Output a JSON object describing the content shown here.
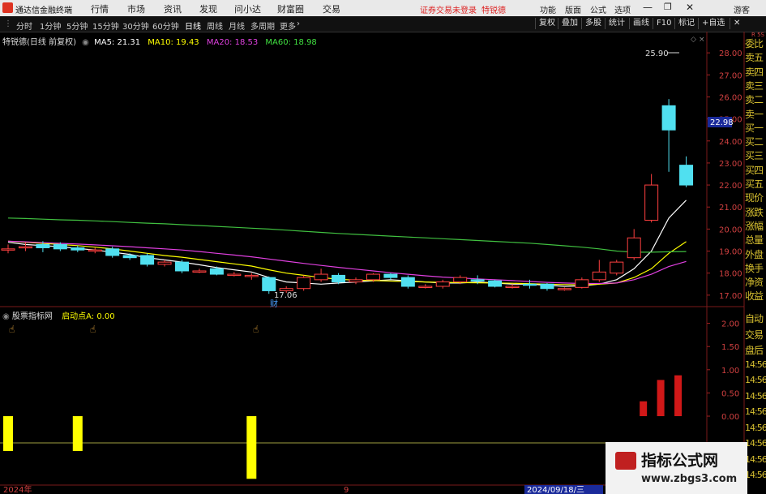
{
  "menubar": {
    "app_title": "通达信金融终端",
    "menus": [
      "行情",
      "市场",
      "资讯",
      "发现",
      "问小达",
      "财富圈",
      "交易"
    ],
    "notice": "证券交易未登录",
    "account": "特锐德",
    "right_menus": [
      "功能",
      "版面",
      "公式",
      "选项"
    ],
    "guest": "游客"
  },
  "toolbar": {
    "periods": [
      "分时",
      "1分钟",
      "5分钟",
      "15分钟",
      "30分钟",
      "60分钟",
      "日线",
      "周线",
      "月线",
      "多周期",
      "更多"
    ],
    "active_period": "日线",
    "right_buttons": [
      "复权",
      "叠加",
      "多股",
      "统计",
      "画线",
      "F10",
      "标记",
      "+自选"
    ]
  },
  "main_chart": {
    "header_name": "特锐德(日线 前复权)",
    "ma_items": [
      {
        "label": "MA5: 21.31",
        "color": "#ffffff"
      },
      {
        "label": "MA10: 19.43",
        "color": "#ffff00"
      },
      {
        "label": "MA20: 18.53",
        "color": "#e040e0"
      },
      {
        "label": "MA60: 18.98",
        "color": "#40e040"
      }
    ],
    "price_ticks": [
      "28.00",
      "27.00",
      "26.00",
      "25.00",
      "24.00",
      "23.00",
      "22.00",
      "21.00",
      "20.00",
      "19.00",
      "18.00",
      "17.00"
    ],
    "current_price": "22.98",
    "high_label": "25.90",
    "low_label": "17.06",
    "fin_marker": "财"
  },
  "indicator": {
    "name": "股票指标网",
    "value_label": "启动点A: 0.00",
    "ticks": [
      "2.00",
      "1.50",
      "1.00",
      "0.50",
      "0.00"
    ]
  },
  "x_axis": {
    "labels": [
      "2024年",
      "9",
      "2024/09/18/三"
    ]
  },
  "right_sidebar": {
    "top_code": "R 5S",
    "items": [
      "委比",
      "卖五",
      "卖四",
      "卖三",
      "卖二",
      "卖一",
      "买一",
      "买二",
      "买三",
      "买四",
      "买五",
      "现价",
      "涨跌",
      "涨幅",
      "总量",
      "外盘",
      "换手",
      "净资",
      "收益"
    ],
    "bottom_items": [
      "自动",
      "交易",
      "盘后",
      "14:56",
      "14:56",
      "14:56",
      "14:56",
      "14:56",
      "14:56",
      "14:56",
      "14:56"
    ]
  },
  "watermark": {
    "title": "指标公式网",
    "url": "www.zbgs3.com"
  },
  "chart_data": {
    "type": "candlestick",
    "title": "特锐德(日线 前复权)",
    "ylim": [
      16.7,
      28.3
    ],
    "candles": [
      {
        "o": 19.1,
        "c": 19.1,
        "h": 19.3,
        "l": 18.9
      },
      {
        "o": 19.2,
        "c": 19.2,
        "h": 19.4,
        "l": 19.0
      },
      {
        "o": 19.3,
        "c": 19.15,
        "h": 19.45,
        "l": 18.95
      },
      {
        "o": 19.3,
        "c": 19.1,
        "h": 19.4,
        "l": 19.0
      },
      {
        "o": 19.15,
        "c": 19.05,
        "h": 19.25,
        "l": 18.95
      },
      {
        "o": 19.0,
        "c": 19.05,
        "h": 19.15,
        "l": 18.9
      },
      {
        "o": 19.1,
        "c": 18.8,
        "h": 19.2,
        "l": 18.7
      },
      {
        "o": 18.8,
        "c": 18.7,
        "h": 18.9,
        "l": 18.6
      },
      {
        "o": 18.8,
        "c": 18.4,
        "h": 18.9,
        "l": 18.3
      },
      {
        "o": 18.4,
        "c": 18.5,
        "h": 18.6,
        "l": 18.3
      },
      {
        "o": 18.5,
        "c": 18.1,
        "h": 18.6,
        "l": 18.0
      },
      {
        "o": 18.1,
        "c": 18.1,
        "h": 18.2,
        "l": 18.0
      },
      {
        "o": 18.2,
        "c": 17.95,
        "h": 18.3,
        "l": 17.9
      },
      {
        "o": 17.95,
        "c": 17.95,
        "h": 18.05,
        "l": 17.85
      },
      {
        "o": 17.9,
        "c": 17.9,
        "h": 18.0,
        "l": 17.7
      },
      {
        "o": 17.8,
        "c": 17.2,
        "h": 17.85,
        "l": 17.06
      },
      {
        "o": 17.2,
        "c": 17.3,
        "h": 17.4,
        "l": 17.1
      },
      {
        "o": 17.3,
        "c": 17.8,
        "h": 17.9,
        "l": 17.2
      },
      {
        "o": 17.7,
        "c": 17.95,
        "h": 18.2,
        "l": 17.6
      },
      {
        "o": 17.9,
        "c": 17.6,
        "h": 18.0,
        "l": 17.5
      },
      {
        "o": 17.6,
        "c": 17.7,
        "h": 17.8,
        "l": 17.5
      },
      {
        "o": 17.7,
        "c": 17.95,
        "h": 18.0,
        "l": 17.6
      },
      {
        "o": 17.95,
        "c": 17.8,
        "h": 18.0,
        "l": 17.7
      },
      {
        "o": 17.8,
        "c": 17.4,
        "h": 17.9,
        "l": 17.3
      },
      {
        "o": 17.4,
        "c": 17.4,
        "h": 17.5,
        "l": 17.3
      },
      {
        "o": 17.4,
        "c": 17.6,
        "h": 17.7,
        "l": 17.3
      },
      {
        "o": 17.6,
        "c": 17.8,
        "h": 17.9,
        "l": 17.5
      },
      {
        "o": 17.7,
        "c": 17.65,
        "h": 17.9,
        "l": 17.5
      },
      {
        "o": 17.65,
        "c": 17.4,
        "h": 17.7,
        "l": 17.35
      },
      {
        "o": 17.4,
        "c": 17.4,
        "h": 17.5,
        "l": 17.3
      },
      {
        "o": 17.5,
        "c": 17.45,
        "h": 17.7,
        "l": 17.3
      },
      {
        "o": 17.5,
        "c": 17.3,
        "h": 17.55,
        "l": 17.2
      },
      {
        "o": 17.25,
        "c": 17.3,
        "h": 17.35,
        "l": 17.2
      },
      {
        "o": 17.35,
        "c": 17.7,
        "h": 17.8,
        "l": 17.3
      },
      {
        "o": 17.7,
        "c": 18.05,
        "h": 18.6,
        "l": 17.6
      },
      {
        "o": 18.0,
        "c": 18.5,
        "h": 18.6,
        "l": 17.9
      },
      {
        "o": 18.7,
        "c": 19.6,
        "h": 20.0,
        "l": 18.6
      },
      {
        "o": 20.4,
        "c": 22.0,
        "h": 22.5,
        "l": 20.3
      },
      {
        "o": 25.6,
        "c": 24.5,
        "h": 25.9,
        "l": 22.6
      },
      {
        "o": 22.9,
        "c": 22.0,
        "h": 23.3,
        "l": 21.9
      }
    ],
    "ma": {
      "MA5": [
        19.4,
        19.3,
        19.25,
        19.2,
        19.12,
        19.05,
        18.95,
        18.85,
        18.7,
        18.6,
        18.5,
        18.38,
        18.25,
        18.15,
        18.05,
        17.8,
        17.6,
        17.55,
        17.5,
        17.55,
        17.6,
        17.65,
        17.7,
        17.65,
        17.6,
        17.55,
        17.55,
        17.6,
        17.55,
        17.5,
        17.5,
        17.45,
        17.4,
        17.42,
        17.5,
        17.7,
        18.2,
        19.0,
        20.5,
        21.31
      ],
      "MA10": [
        19.45,
        19.4,
        19.35,
        19.3,
        19.25,
        19.18,
        19.1,
        19.0,
        18.9,
        18.8,
        18.72,
        18.62,
        18.52,
        18.42,
        18.32,
        18.15,
        18.0,
        17.9,
        17.8,
        17.72,
        17.68,
        17.66,
        17.64,
        17.62,
        17.6,
        17.58,
        17.57,
        17.56,
        17.55,
        17.54,
        17.52,
        17.5,
        17.48,
        17.47,
        17.5,
        17.55,
        17.8,
        18.2,
        18.9,
        19.43
      ],
      "MA20": [
        19.45,
        19.42,
        19.38,
        19.35,
        19.32,
        19.28,
        19.24,
        19.2,
        19.15,
        19.1,
        19.05,
        18.98,
        18.9,
        18.82,
        18.74,
        18.64,
        18.54,
        18.44,
        18.35,
        18.26,
        18.18,
        18.1,
        18.02,
        17.95,
        17.88,
        17.82,
        17.78,
        17.74,
        17.7,
        17.66,
        17.62,
        17.58,
        17.55,
        17.53,
        17.53,
        17.55,
        17.7,
        17.95,
        18.3,
        18.53
      ],
      "MA60": [
        20.5,
        20.48,
        20.45,
        20.42,
        20.4,
        20.37,
        20.34,
        20.3,
        20.27,
        20.24,
        20.2,
        20.16,
        20.12,
        20.08,
        20.04,
        20.0,
        19.95,
        19.9,
        19.85,
        19.8,
        19.76,
        19.72,
        19.68,
        19.64,
        19.6,
        19.56,
        19.52,
        19.48,
        19.44,
        19.4,
        19.36,
        19.3,
        19.24,
        19.18,
        19.1,
        19.0,
        18.95,
        18.95,
        18.97,
        18.98
      ]
    },
    "indicator_bars": [
      {
        "index": 0,
        "value": -0.75,
        "color": "#ffff00"
      },
      {
        "index": 4,
        "value": -0.75,
        "color": "#ffff00"
      },
      {
        "index": 14,
        "value": -1.35,
        "color": "#ffff00"
      },
      {
        "index": 37,
        "value": 0.32,
        "color": "#d01818"
      },
      {
        "index": 38,
        "value": 0.78,
        "color": "#d01818"
      },
      {
        "index": 39,
        "value": 0.88,
        "color": "#d01818"
      }
    ],
    "indicator_ylim": [
      -1.45,
      2.15
    ]
  }
}
